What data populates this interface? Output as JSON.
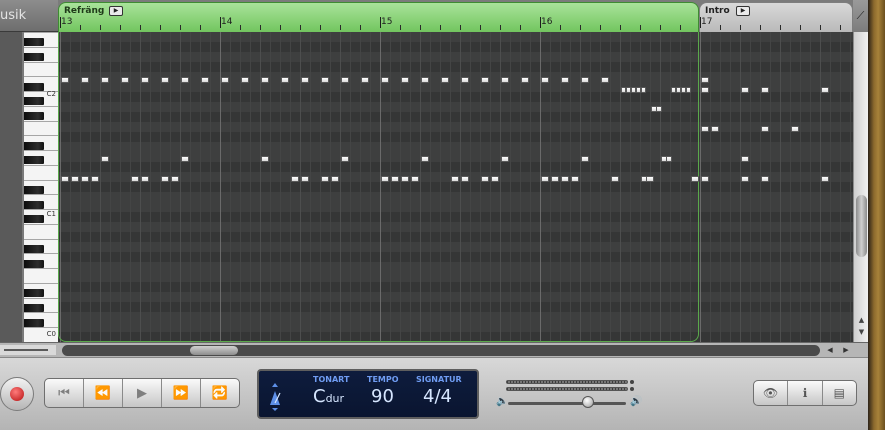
{
  "track_header": {
    "name_fragment": "usik"
  },
  "keyboard": {
    "labels": [
      "C2",
      "C1",
      "C0"
    ]
  },
  "ruler": {
    "bars": [
      "13",
      "14",
      "15",
      "16",
      "17"
    ],
    "regions": [
      {
        "name": "Refräng",
        "color": "#7fcf6b"
      },
      {
        "name": "Intro",
        "color": "#c6c6c6"
      }
    ],
    "play_glyph": "▶"
  },
  "scrollbar": {
    "up": "▲",
    "down": "▼",
    "left": "◀",
    "right": "▶"
  },
  "transport": {
    "buttons": [
      "⏮",
      "⏪",
      "▶",
      "⏩",
      "🔁"
    ]
  },
  "lcd": {
    "key_label": "TONART",
    "key_value": "C",
    "key_mode": "dur",
    "tempo_label": "TEMPO",
    "tempo_value": "90",
    "signature_label": "SIGNATUR",
    "signature_value": "4/4"
  },
  "master": {
    "vol_low_icon": "🔈",
    "vol_high_icon": "🔊"
  },
  "right_buttons": {
    "view": "👁",
    "info": "ℹ",
    "media": "▤"
  },
  "colors": {
    "accent_green": "#7fcf6b",
    "lcd_bg": "#0e1c3d",
    "record_red": "#c41818"
  }
}
